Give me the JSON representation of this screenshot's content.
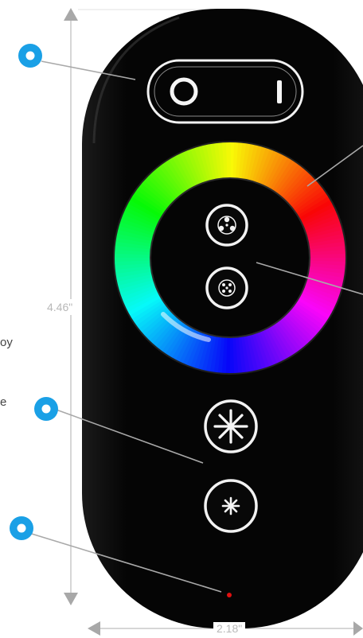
{
  "dimensions": {
    "height_label": "4.46\"",
    "width_label": "2.18\""
  },
  "edge_text": {
    "fragment_1": "oy",
    "fragment_2": "e"
  },
  "colors": {
    "callout_dot": "#1aa0e6",
    "leader_line": "#a9a9a9",
    "dimension_line": "#c8c8c8",
    "remote_body": "#060606",
    "button_outline": "#f2f2f2",
    "indicator_led": "#e01010"
  },
  "callouts": [
    {
      "name": "callout-power-switch",
      "icon": "callout-dot"
    },
    {
      "name": "callout-color-ring",
      "icon": "none"
    },
    {
      "name": "callout-mode-buttons",
      "icon": "none"
    },
    {
      "name": "callout-brightness-buttons",
      "icon": "callout-dot"
    },
    {
      "name": "callout-indicator-led",
      "icon": "callout-dot"
    }
  ],
  "icons": {
    "power_off": "circle-o-icon",
    "power_on": "bar-i-icon",
    "mode_up": "four-dot-icon",
    "mode_down": "five-dot-icon",
    "brightness_up": "large-asterisk-icon",
    "brightness_down": "small-asterisk-icon"
  }
}
